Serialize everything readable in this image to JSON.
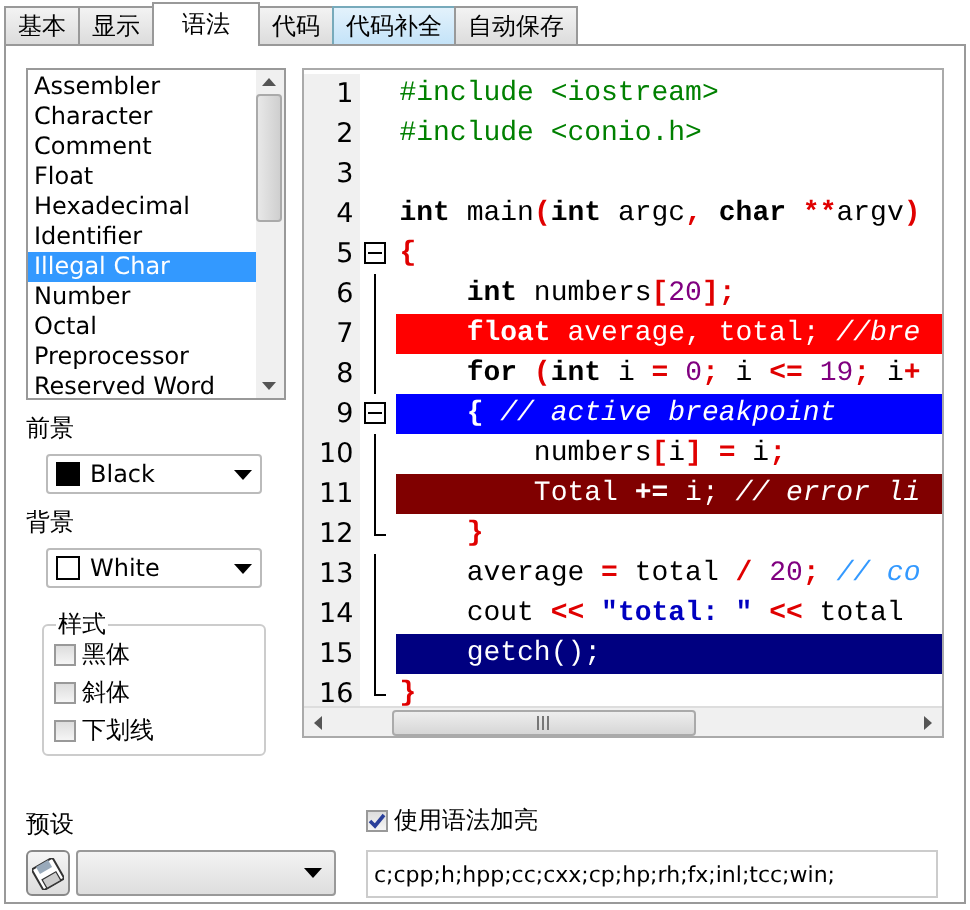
{
  "tabs": [
    {
      "label": "基本",
      "selected": false,
      "hover": false
    },
    {
      "label": "显示",
      "selected": false,
      "hover": false
    },
    {
      "label": "语法",
      "selected": true,
      "hover": false
    },
    {
      "label": "代码",
      "selected": false,
      "hover": false
    },
    {
      "label": "代码补全",
      "selected": false,
      "hover": true
    },
    {
      "label": "自动保存",
      "selected": false,
      "hover": false
    }
  ],
  "token_list": {
    "items": [
      {
        "label": "Assembler",
        "selected": false
      },
      {
        "label": "Character",
        "selected": false
      },
      {
        "label": "Comment",
        "selected": false
      },
      {
        "label": "Float",
        "selected": false
      },
      {
        "label": "Hexadecimal",
        "selected": false
      },
      {
        "label": "Identifier",
        "selected": false
      },
      {
        "label": "Illegal Char",
        "selected": true
      },
      {
        "label": "Number",
        "selected": false
      },
      {
        "label": "Octal",
        "selected": false
      },
      {
        "label": "Preprocessor",
        "selected": false
      },
      {
        "label": "Reserved Word",
        "selected": false
      }
    ]
  },
  "foreground": {
    "label": "前景",
    "value": "Black",
    "color": "#000000"
  },
  "background": {
    "label": "背景",
    "value": "White",
    "color": "#ffffff"
  },
  "style_group": {
    "title": "样式",
    "options": [
      {
        "label": "黑体",
        "checked": false
      },
      {
        "label": "斜体",
        "checked": false
      },
      {
        "label": "下划线",
        "checked": false
      }
    ]
  },
  "code_lines": [
    {
      "number": "1",
      "kind": "normal",
      "fold_start": false,
      "fold_end": false,
      "tokens": [
        {
          "text": "#include <iostream>",
          "kind": "preproc"
        }
      ]
    },
    {
      "number": "2",
      "kind": "normal",
      "fold_start": false,
      "fold_end": false,
      "tokens": [
        {
          "text": "#include <conio.h>",
          "kind": "preproc"
        }
      ]
    },
    {
      "number": "3",
      "kind": "normal",
      "fold_start": false,
      "fold_end": false
    },
    {
      "number": "4",
      "kind": "normal",
      "fold_start": false,
      "fold_end": false,
      "tokens": [
        {
          "text": "int",
          "kind": "keyword"
        },
        {
          "text": " main",
          "kind": "plain"
        },
        {
          "text": "(",
          "kind": "symbol"
        },
        {
          "text": "int",
          "kind": "keyword"
        },
        {
          "text": " argc",
          "kind": "plain"
        },
        {
          "text": ",",
          "kind": "symbol"
        },
        {
          "text": " char",
          "kind": "keyword"
        },
        {
          "text": " **",
          "kind": "symbol"
        },
        {
          "text": "argv",
          "kind": "plain"
        },
        {
          "text": ")",
          "kind": "symbol"
        }
      ]
    },
    {
      "number": "5",
      "kind": "normal",
      "fold_start": true,
      "fold_end": false,
      "tokens": [
        {
          "text": "{",
          "kind": "symbol"
        }
      ]
    },
    {
      "number": "6",
      "kind": "normal",
      "fold_start": false,
      "fold_end": false,
      "tokens": [
        {
          "text": "    int",
          "kind": "keyword"
        },
        {
          "text": " numbers",
          "kind": "plain"
        },
        {
          "text": "[",
          "kind": "symbol"
        },
        {
          "text": "20",
          "kind": "number"
        },
        {
          "text": "];",
          "kind": "symbol"
        }
      ]
    },
    {
      "number": "7",
      "kind": "breakpoint",
      "fold_start": false,
      "fold_end": false,
      "tokens": [
        {
          "text": "    float",
          "kind": "keyword"
        },
        {
          "text": " average, total;",
          "kind": "plain"
        },
        {
          "text": " //bre",
          "kind": "comment"
        }
      ]
    },
    {
      "number": "8",
      "kind": "normal",
      "fold_start": false,
      "fold_end": false,
      "tokens": [
        {
          "text": "    for",
          "kind": "keyword"
        },
        {
          "text": " (",
          "kind": "symbol"
        },
        {
          "text": "int",
          "kind": "keyword"
        },
        {
          "text": " i",
          "kind": "plain"
        },
        {
          "text": " =",
          "kind": "symbol"
        },
        {
          "text": " 0",
          "kind": "number"
        },
        {
          "text": ";",
          "kind": "symbol"
        },
        {
          "text": " i",
          "kind": "plain"
        },
        {
          "text": " <=",
          "kind": "symbol"
        },
        {
          "text": " 19",
          "kind": "number"
        },
        {
          "text": ";",
          "kind": "symbol"
        },
        {
          "text": " i",
          "kind": "plain"
        },
        {
          "text": "+",
          "kind": "symbol"
        }
      ]
    },
    {
      "number": "9",
      "kind": "active_breakpoint",
      "fold_start": true,
      "fold_end": false,
      "tokens": [
        {
          "text": "    {",
          "kind": "symbol"
        },
        {
          "text": " // active breakpoint",
          "kind": "comment"
        }
      ]
    },
    {
      "number": "10",
      "kind": "normal",
      "fold_start": false,
      "fold_end": false,
      "tokens": [
        {
          "text": "        numbers",
          "kind": "plain"
        },
        {
          "text": "[",
          "kind": "symbol"
        },
        {
          "text": "i",
          "kind": "plain"
        },
        {
          "text": "]",
          "kind": "symbol"
        },
        {
          "text": " =",
          "kind": "symbol"
        },
        {
          "text": " i",
          "kind": "plain"
        },
        {
          "text": ";",
          "kind": "symbol"
        }
      ]
    },
    {
      "number": "11",
      "kind": "error",
      "fold_start": false,
      "fold_end": false,
      "tokens": [
        {
          "text": "        Total",
          "kind": "plain"
        },
        {
          "text": " +=",
          "kind": "symbol"
        },
        {
          "text": " i;",
          "kind": "plain"
        },
        {
          "text": " // error li",
          "kind": "comment"
        }
      ]
    },
    {
      "number": "12",
      "kind": "normal",
      "fold_start": false,
      "fold_end": true,
      "tokens": [
        {
          "text": "    }",
          "kind": "symbol"
        }
      ]
    },
    {
      "number": "13",
      "kind": "normal",
      "fold_start": false,
      "fold_end": false,
      "tokens": [
        {
          "text": "    average",
          "kind": "plain"
        },
        {
          "text": " =",
          "kind": "symbol"
        },
        {
          "text": " total",
          "kind": "plain"
        },
        {
          "text": " /",
          "kind": "symbol"
        },
        {
          "text": " 20",
          "kind": "number"
        },
        {
          "text": ";",
          "kind": "symbol"
        },
        {
          "text": " // co",
          "kind": "comment"
        }
      ]
    },
    {
      "number": "14",
      "kind": "normal",
      "fold_start": false,
      "fold_end": false,
      "tokens": [
        {
          "text": "    cout",
          "kind": "plain"
        },
        {
          "text": " <<",
          "kind": "symbol"
        },
        {
          "text": " \"total: \"",
          "kind": "string"
        },
        {
          "text": " <<",
          "kind": "symbol"
        },
        {
          "text": " total",
          "kind": "plain"
        }
      ]
    },
    {
      "number": "15",
      "kind": "execution",
      "fold_start": false,
      "fold_end": false,
      "tokens": [
        {
          "text": "    getch();",
          "kind": "plain"
        }
      ]
    },
    {
      "number": "16",
      "kind": "normal",
      "fold_start": false,
      "fold_end": true,
      "tokens": [
        {
          "text": "}",
          "kind": "symbol"
        }
      ]
    }
  ],
  "preset": {
    "label": "预设"
  },
  "syntax_highlight": {
    "label": "使用语法加亮",
    "checked": true
  },
  "extensions": {
    "value": "c;cpp;h;hpp;cc;cxx;cp;hp;rh;fx;inl;tcc;win;"
  }
}
